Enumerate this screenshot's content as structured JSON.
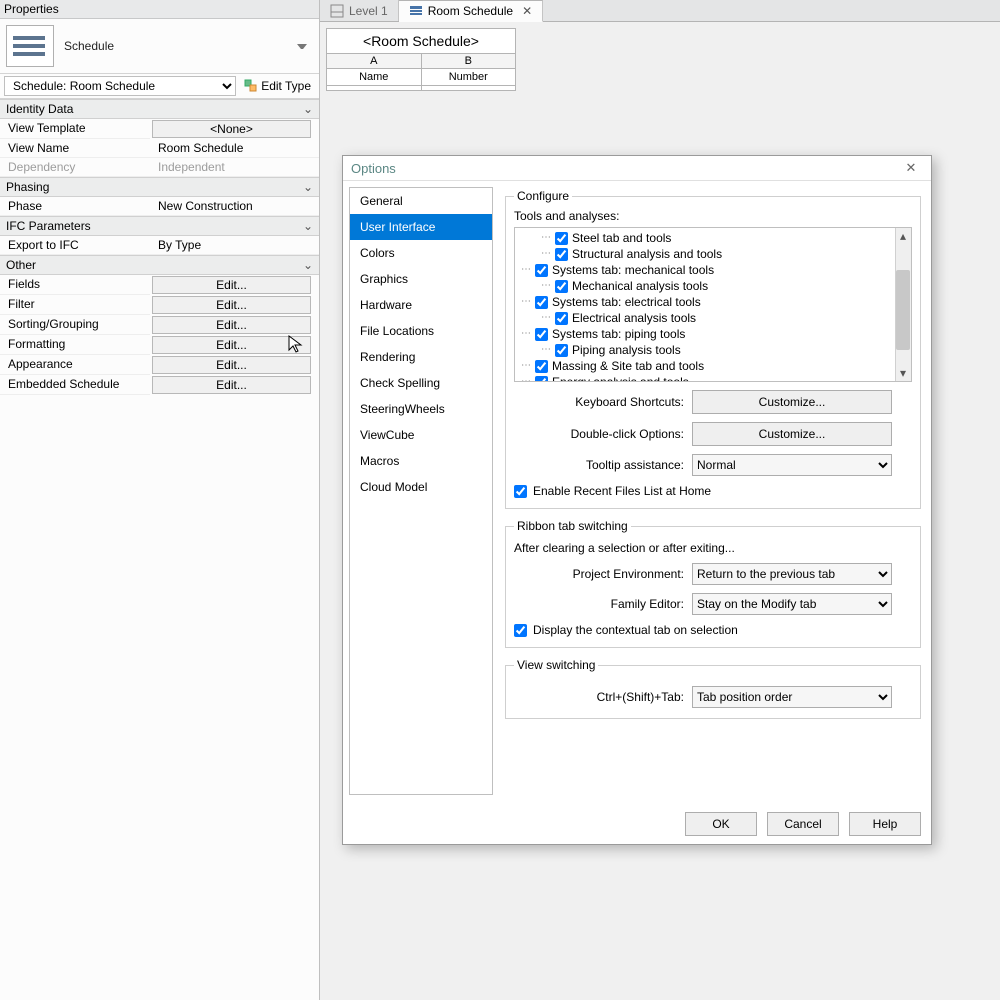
{
  "properties": {
    "title": "Properties",
    "type_label": "Schedule",
    "family_selector": "Schedule: Room Schedule",
    "edit_type_label": "Edit Type",
    "groups": {
      "identity": {
        "title": "Identity Data",
        "view_template_label": "View Template",
        "view_template_value": "<None>",
        "view_name_label": "View Name",
        "view_name_value": "Room Schedule",
        "dependency_label": "Dependency",
        "dependency_value": "Independent"
      },
      "phasing": {
        "title": "Phasing",
        "phase_label": "Phase",
        "phase_value": "New Construction"
      },
      "ifc": {
        "title": "IFC Parameters",
        "export_label": "Export to IFC",
        "export_value": "By Type"
      },
      "other": {
        "title": "Other",
        "rows": [
          {
            "label": "Fields",
            "button": "Edit..."
          },
          {
            "label": "Filter",
            "button": "Edit..."
          },
          {
            "label": "Sorting/Grouping",
            "button": "Edit..."
          },
          {
            "label": "Formatting",
            "button": "Edit..."
          },
          {
            "label": "Appearance",
            "button": "Edit..."
          },
          {
            "label": "Embedded Schedule",
            "button": "Edit..."
          }
        ]
      }
    }
  },
  "doc_tabs": {
    "inactive": "Level 1",
    "active": "Room Schedule"
  },
  "schedule_view": {
    "title": "<Room Schedule>",
    "col_letters": [
      "A",
      "B"
    ],
    "col_names": [
      "Name",
      "Number"
    ]
  },
  "options_dialog": {
    "title": "Options",
    "nav": [
      "General",
      "User Interface",
      "Colors",
      "Graphics",
      "Hardware",
      "File Locations",
      "Rendering",
      "Check Spelling",
      "SteeringWheels",
      "ViewCube",
      "Macros",
      "Cloud Model"
    ],
    "nav_selected": 1,
    "configure": {
      "legend": "Configure",
      "tree_title": "Tools and analyses:",
      "tree": [
        {
          "level": 1,
          "text": "Steel tab and tools",
          "checked": true
        },
        {
          "level": 1,
          "text": "Structural analysis and tools",
          "checked": true
        },
        {
          "level": 0,
          "text": "Systems tab: mechanical tools",
          "checked": true
        },
        {
          "level": 1,
          "text": "Mechanical analysis tools",
          "checked": true
        },
        {
          "level": 0,
          "text": "Systems tab: electrical tools",
          "checked": true
        },
        {
          "level": 1,
          "text": "Electrical analysis tools",
          "checked": true
        },
        {
          "level": 0,
          "text": "Systems tab: piping tools",
          "checked": true
        },
        {
          "level": 1,
          "text": "Piping analysis tools",
          "checked": true
        },
        {
          "level": 0,
          "text": "Massing & Site tab and tools",
          "checked": true
        },
        {
          "level": 0,
          "text": "Energy analysis and tools",
          "checked": true
        }
      ],
      "kb_shortcuts_label": "Keyboard Shortcuts:",
      "kb_shortcuts_btn": "Customize...",
      "dblclick_label": "Double-click Options:",
      "dblclick_btn": "Customize...",
      "tooltip_label": "Tooltip assistance:",
      "tooltip_value": "Normal",
      "recent_files_label": "Enable Recent Files List at Home"
    },
    "ribbon": {
      "legend": "Ribbon tab switching",
      "desc": "After clearing a selection or after exiting...",
      "proj_env_label": "Project Environment:",
      "proj_env_value": "Return to the previous tab",
      "family_editor_label": "Family Editor:",
      "family_editor_value": "Stay on the Modify tab",
      "contextual_label": "Display the contextual tab on selection"
    },
    "view_switching": {
      "legend": "View switching",
      "ctrl_label": "Ctrl+(Shift)+Tab:",
      "ctrl_value": "Tab position order"
    },
    "buttons": {
      "ok": "OK",
      "cancel": "Cancel",
      "help": "Help"
    }
  }
}
